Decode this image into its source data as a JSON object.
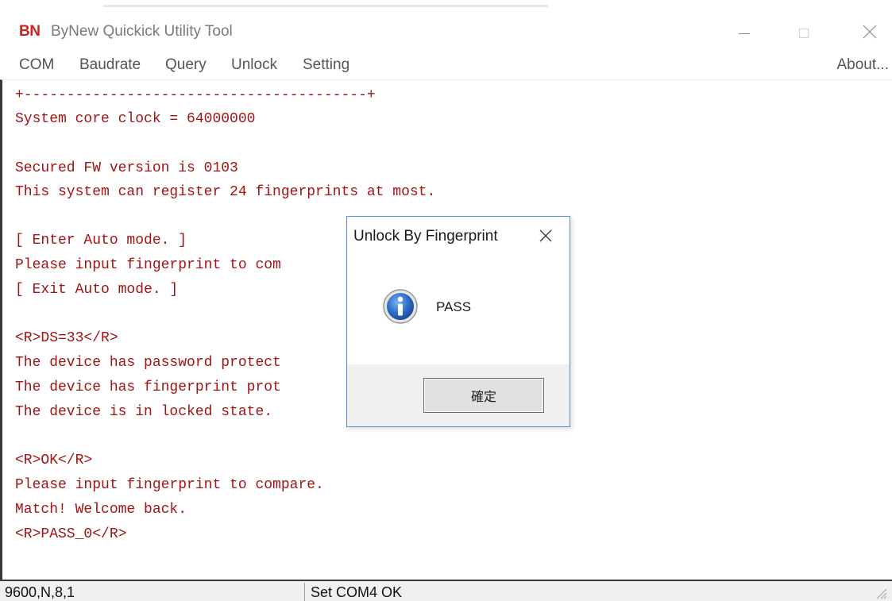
{
  "titlebar": {
    "logo": "BN",
    "title": "ByNew Quickick Utility Tool"
  },
  "menubar": {
    "items": [
      "COM",
      "Baudrate",
      "Query",
      "Unlock",
      "Setting"
    ],
    "about": "About..."
  },
  "terminal": {
    "lines": [
      "+----------------------------------------+",
      "System core clock = 64000000",
      "",
      "Secured FW version is 0103",
      "This system can register 24 fingerprints at most.",
      "",
      "[ Enter Auto mode. ]",
      "Please input fingerprint to com",
      "[ Exit Auto mode. ]",
      "",
      "<R>DS=33</R>",
      "The device has password protect",
      "The device has fingerprint prot",
      "The device is in locked state.",
      "",
      "<R>OK</R>",
      "Please input fingerprint to compare.",
      "Match! Welcome back.",
      "<R>PASS_0</R>"
    ],
    "text_color": "#a01414"
  },
  "dialog": {
    "title": "Unlock By Fingerprint",
    "message": "PASS",
    "ok_label": "確定",
    "icon": "info-icon",
    "border_color": "#5b8fd4"
  },
  "statusbar": {
    "left": "9600,N,8,1",
    "right": "Set COM4 OK"
  }
}
